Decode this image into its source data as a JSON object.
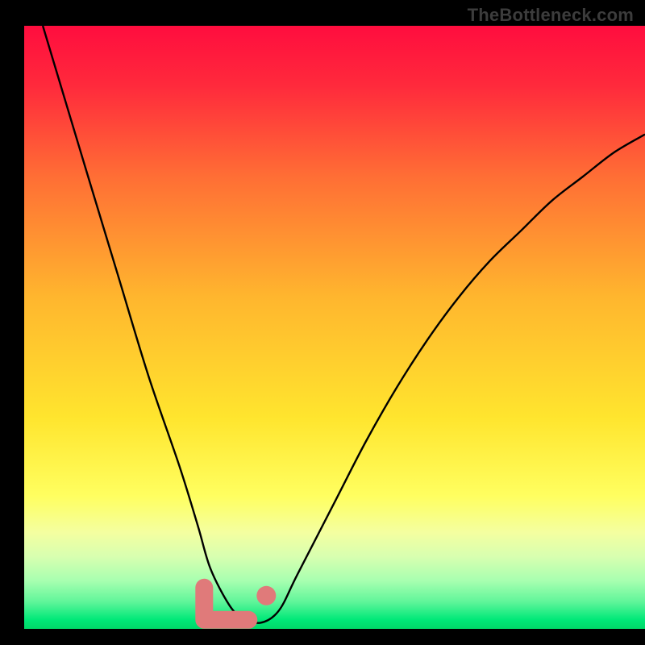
{
  "watermark": "TheBottleneck.com",
  "chart_data": {
    "type": "line",
    "title": "",
    "xlabel": "",
    "ylabel": "",
    "xlim": [
      0,
      100
    ],
    "ylim": [
      0,
      100
    ],
    "grid": false,
    "legend": false,
    "series": [
      {
        "name": "curve",
        "x": [
          3,
          10,
          15,
          20,
          25,
          28,
          30,
          33,
          35,
          38,
          41,
          44,
          50,
          55,
          60,
          65,
          70,
          75,
          80,
          85,
          90,
          95,
          100
        ],
        "values": [
          100,
          76,
          59,
          42,
          27,
          17,
          10,
          4,
          2,
          1,
          3,
          9,
          21,
          31,
          40,
          48,
          55,
          61,
          66,
          71,
          75,
          79,
          82
        ]
      }
    ],
    "highlight": {
      "name": "optimal-region",
      "x_range": [
        29,
        39
      ],
      "y_level": 1.5
    },
    "gradient_stops": [
      {
        "offset": 0.0,
        "color": "#FF0D3E"
      },
      {
        "offset": 0.1,
        "color": "#FF2A3C"
      },
      {
        "offset": 0.25,
        "color": "#FF6E35"
      },
      {
        "offset": 0.45,
        "color": "#FFB62E"
      },
      {
        "offset": 0.65,
        "color": "#FFE52E"
      },
      {
        "offset": 0.78,
        "color": "#FFFF60"
      },
      {
        "offset": 0.84,
        "color": "#F4FFA0"
      },
      {
        "offset": 0.88,
        "color": "#D8FFB0"
      },
      {
        "offset": 0.92,
        "color": "#A8FFB0"
      },
      {
        "offset": 0.955,
        "color": "#60F59A"
      },
      {
        "offset": 0.985,
        "color": "#00E878"
      },
      {
        "offset": 1.0,
        "color": "#00D868"
      }
    ]
  },
  "layout": {
    "inner_left": 30,
    "inner_top": 32,
    "inner_right": 800,
    "inner_bottom": 780
  }
}
